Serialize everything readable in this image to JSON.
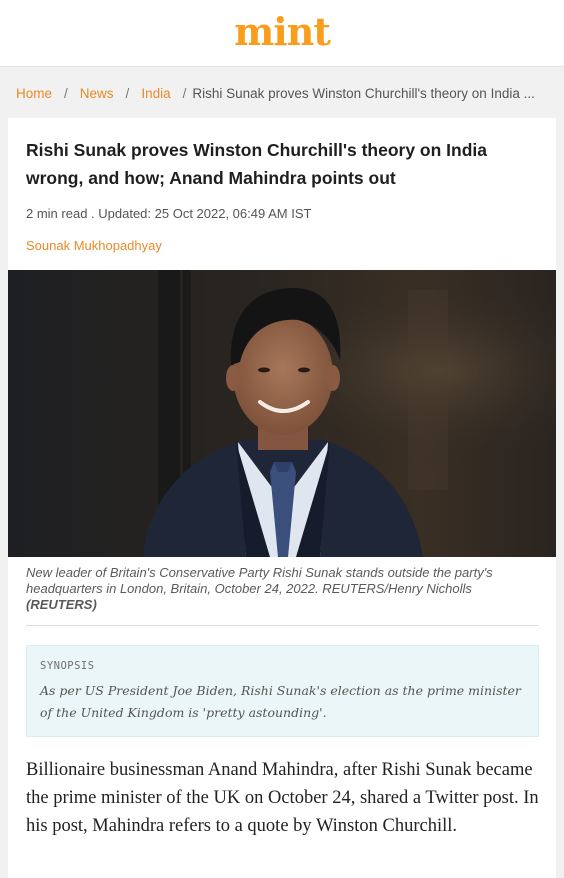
{
  "brand": {
    "logo_text": "mint"
  },
  "breadcrumb": {
    "home": "Home",
    "news": "News",
    "india": "India",
    "current": "Rishi Sunak proves Winston Churchill's theory on India ..."
  },
  "article": {
    "headline": "Rishi Sunak proves Winston Churchill's theory on India wrong, and how; Anand Mahindra points out",
    "meta": "2 min read . Updated: 25 Oct 2022, 06:49 AM IST",
    "author": "Sounak Mukhopadhyay",
    "image_caption": "New leader of Britain's Conservative Party Rishi Sunak stands outside the party's headquarters in London, Britain, October 24, 2022. REUTERS/Henry Nicholls",
    "image_credit": "(REUTERS)",
    "synopsis_label": "SYNOPSIS",
    "synopsis_text": "As per US President Joe Biden, Rishi Sunak's election as the prime minister of the United Kingdom is 'pretty astounding'.",
    "body_paragraph": "Billionaire businessman Anand Mahindra, after Rishi Sunak became the prime minister of the UK on October 24, shared a Twitter post. In his post, Mahindra refers to a quote by Winston Churchill."
  },
  "colors": {
    "brand_orange": "#f99d1c",
    "link_orange": "#e98a27",
    "synopsis_bg": "#eaf6f7"
  }
}
